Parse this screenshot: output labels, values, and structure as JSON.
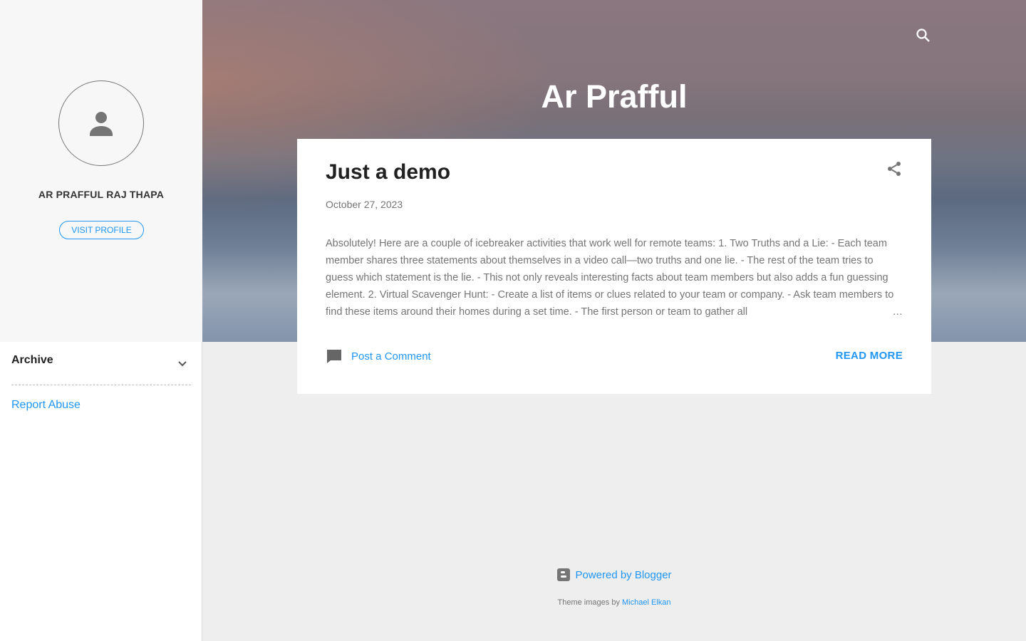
{
  "sidebar": {
    "profile_name": "AR PRAFFUL RAJ THAPA",
    "visit_profile": "VISIT PROFILE",
    "archive_label": "Archive",
    "report_abuse": "Report Abuse"
  },
  "header": {
    "blog_title": "Ar Prafful"
  },
  "post": {
    "title": "Just a demo",
    "date": "October 27, 2023",
    "snippet": " Absolutely! Here are a couple of icebreaker activities that work well for remote teams: 1. Two Truths and a Lie:    - Each team member shares three statements about themselves in a video call—two truths and one lie.    - The rest of the team tries to guess which statement is the lie.    - This not only reveals interesting facts about team members but also adds a fun guessing element. 2. Virtual Scavenger Hunt:    - Create a list of items or clues related to your team or company.    - Ask team members to find these items around their homes during a set time.    - The first person or team to gather all",
    "ellipsis": "…",
    "comment_label": "Post a Comment",
    "read_more": "READ MORE"
  },
  "footer": {
    "powered_by": "Powered by Blogger",
    "theme_prefix": "Theme images by ",
    "theme_author": "Michael Elkan"
  },
  "colors": {
    "accent": "#2196f3",
    "text_dark": "#212121",
    "text_muted": "#757575"
  },
  "icons": [
    "person-icon",
    "search-icon",
    "share-icon",
    "chevron-down-icon",
    "comment-icon",
    "blogger-icon"
  ]
}
